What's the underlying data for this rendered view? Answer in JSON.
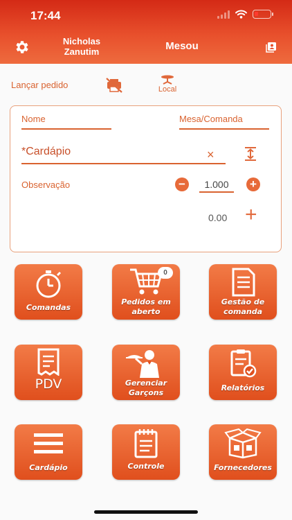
{
  "status_bar": {
    "time": "17:44"
  },
  "header": {
    "user_name": "Nicholas Zanutim",
    "title": "Mesou"
  },
  "toolbar": {
    "launch_label": "Lançar pedido",
    "local_label": "Local"
  },
  "form": {
    "name_label": "Nome",
    "table_label": "Mesa/Comanda",
    "menu_label": "*Cardápio",
    "clear_symbol": "×",
    "observation_label": "Observação",
    "quantity": "1.000",
    "price": "0.00"
  },
  "tiles": [
    {
      "label": "Comandas",
      "icon": "stopwatch-icon"
    },
    {
      "label": "Pedidos em aberto",
      "icon": "shopping-cart-icon",
      "badge": "0"
    },
    {
      "label": "Gestão de comanda",
      "icon": "document-icon"
    },
    {
      "label": "PDV",
      "icon": "receipt-icon"
    },
    {
      "label": "Gerenciar Garçons",
      "icon": "waiter-icon"
    },
    {
      "label": "Relatórios",
      "icon": "clipboard-check-icon"
    },
    {
      "label": "Cardápio",
      "icon": "menu-lines-icon"
    },
    {
      "label": "Controle",
      "icon": "notepad-icon"
    },
    {
      "label": "Fornecedores",
      "icon": "boxes-icon"
    }
  ],
  "colors": {
    "accent": "#e04f1d",
    "accent_light": "#f27b47",
    "header_top": "#d42a16"
  }
}
